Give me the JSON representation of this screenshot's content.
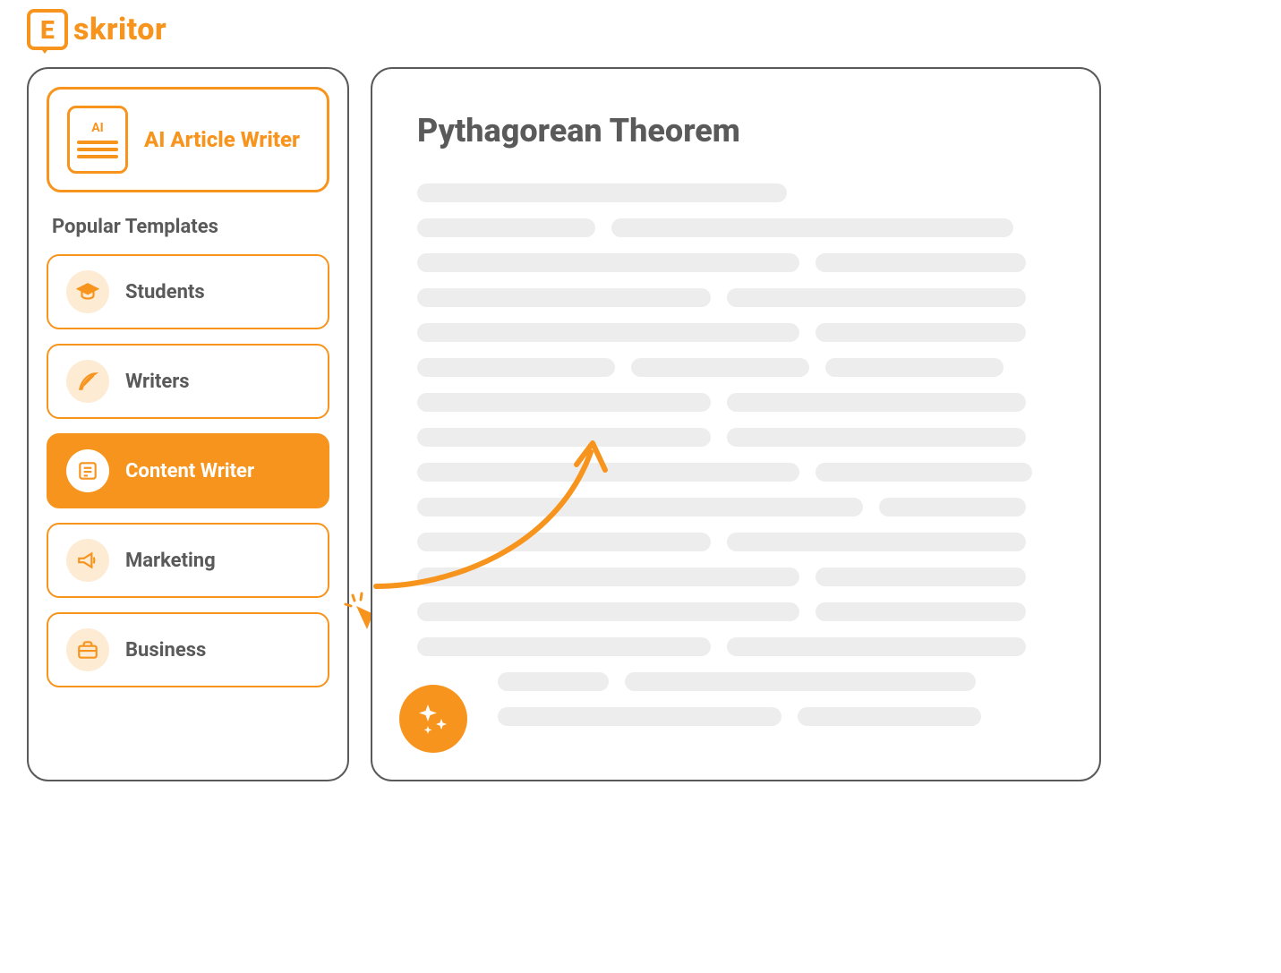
{
  "brand": {
    "letter": "E",
    "name": "skritor"
  },
  "sidebar": {
    "ai_writer": {
      "icon_label": "AI",
      "title": "AI Article Writer"
    },
    "section_title": "Popular Templates",
    "templates": [
      {
        "label": "Students",
        "icon": "graduation-cap-icon",
        "active": false
      },
      {
        "label": "Writers",
        "icon": "feather-icon",
        "active": false
      },
      {
        "label": "Content Writer",
        "icon": "document-icon",
        "active": true
      },
      {
        "label": "Marketing",
        "icon": "megaphone-icon",
        "active": false
      },
      {
        "label": "Business",
        "icon": "briefcase-icon",
        "active": false
      }
    ]
  },
  "content": {
    "title": "Pythagorean Theorem"
  },
  "colors": {
    "accent": "#f7941d",
    "text": "#5a5a5a",
    "placeholder": "#ededed",
    "icon_bg": "#fdebd4"
  }
}
